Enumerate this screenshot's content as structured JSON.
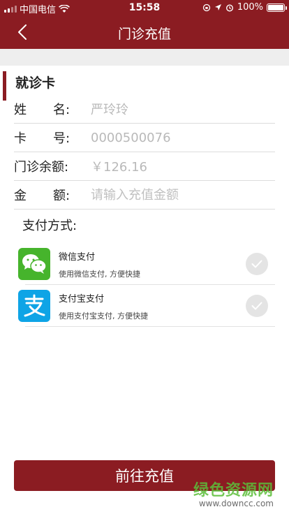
{
  "status_bar": {
    "carrier": "中国电信",
    "time": "15:58",
    "battery": "100%"
  },
  "nav": {
    "title": "门诊充值"
  },
  "card": {
    "section_title": "就诊卡",
    "fields": [
      {
        "label_left": "姓",
        "label_right": "名:",
        "value": "严玲玲"
      },
      {
        "label_left": "卡",
        "label_right": "号:",
        "value": "0000500076"
      },
      {
        "label_left": "门诊余额:",
        "label_right": "",
        "value": "￥126.16"
      },
      {
        "label_left": "金",
        "label_right": "额:",
        "placeholder": "请输入充值金额"
      }
    ]
  },
  "payment": {
    "title": "支付方式:",
    "methods": [
      {
        "name": "微信支付",
        "desc": "使用微信支付, 方便快捷"
      },
      {
        "name": "支付宝支付",
        "desc": "使用支付宝支付, 方便快捷"
      }
    ]
  },
  "submit_label": "前往充值",
  "watermark": {
    "title": "绿色资源网",
    "url": "www.downcc.com"
  },
  "colors": {
    "brand": "#8b1c22",
    "wechat": "#46b42c",
    "alipay": "#0ea4e6"
  }
}
